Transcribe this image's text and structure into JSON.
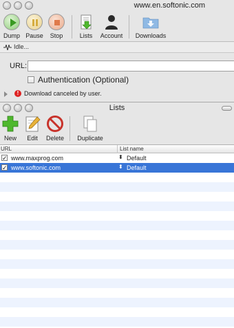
{
  "main_window": {
    "title": "www.en.softonic.com",
    "toolbar": {
      "dump": "Dump",
      "pause": "Pause",
      "stop": "Stop",
      "lists": "Lists",
      "account": "Account",
      "downloads": "Downloads"
    },
    "status": "Idle...",
    "url_label": "URL:",
    "url_value": "",
    "auth_label": "Authentication (Optional)",
    "message": "Download canceled by user."
  },
  "lists_window": {
    "title": "Lists",
    "toolbar": {
      "new": "New",
      "edit": "Edit",
      "delete": "Delete",
      "duplicate": "Duplicate"
    },
    "columns": [
      "URL",
      "List name"
    ],
    "rows": [
      {
        "url": "www.maxprog.com",
        "list": "Default",
        "checked": true
      },
      {
        "url": "www.softonic.com",
        "list": "Default",
        "checked": true
      }
    ]
  },
  "colors": {
    "selection": "#3875d7",
    "stripe": "#edf3fe",
    "new_green": "#4fb82e",
    "delete_red": "#c8332b"
  }
}
